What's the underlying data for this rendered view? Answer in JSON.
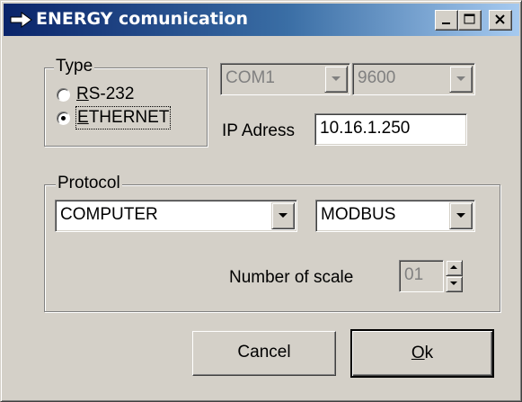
{
  "window": {
    "title": "ENERGY comunication",
    "title_icon": "arrow-right-icon",
    "controls": [
      "minimize-icon",
      "maximize-icon",
      "close-icon"
    ]
  },
  "type_group": {
    "legend": "Type",
    "options": [
      {
        "accel": "R",
        "rest": "S-232",
        "checked": false
      },
      {
        "accel": "E",
        "rest": "THERNET",
        "checked": true
      }
    ]
  },
  "serial": {
    "port": {
      "value": "COM1",
      "enabled": false
    },
    "baud": {
      "value": "9600",
      "enabled": false
    }
  },
  "ip": {
    "label": "IP Adress",
    "value": "10.16.1.250"
  },
  "protocol_group": {
    "legend": "Protocol",
    "device": {
      "value": "COMPUTER"
    },
    "protocol": {
      "value": "MODBUS"
    },
    "scale_label": "Number of scale",
    "scale_value": "01"
  },
  "buttons": {
    "cancel": "Cancel",
    "ok_accel": "O",
    "ok_rest": "k"
  },
  "colors": {
    "face": "#d4d0c8",
    "title_start": "#0a246a",
    "title_end": "#a6caf0"
  }
}
